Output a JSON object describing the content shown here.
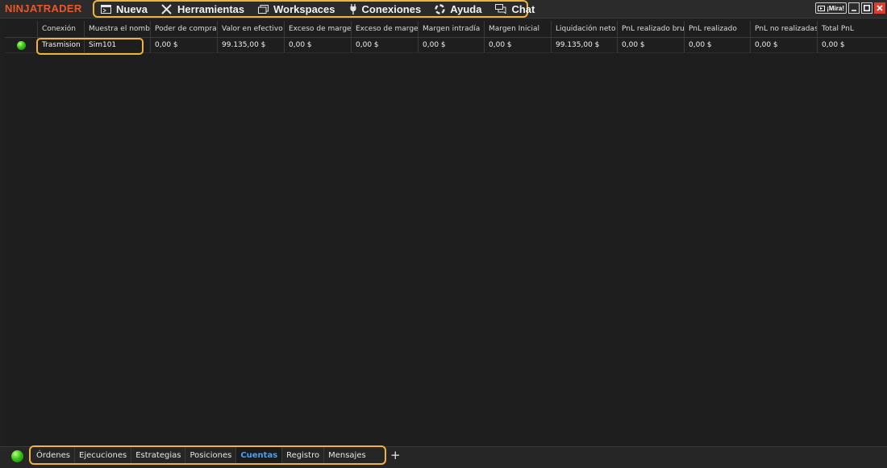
{
  "app": {
    "logo": "NINJATRADER"
  },
  "menu": [
    {
      "label": "Nueva",
      "icon": "new-window-icon"
    },
    {
      "label": "Herramientas",
      "icon": "tools-icon"
    },
    {
      "label": "Workspaces",
      "icon": "workspaces-icon"
    },
    {
      "label": "Conexiones",
      "icon": "plug-icon"
    },
    {
      "label": "Ayuda",
      "icon": "help-ring-icon"
    },
    {
      "label": "Chat",
      "icon": "chat-icon"
    }
  ],
  "window_controls": {
    "mira_label": "¡Mira!"
  },
  "accounts": {
    "columns": [
      "Conexión",
      "Muestra el nomb",
      "Poder de compra",
      "Valor en efectivo",
      "Exceso de marge",
      "Exceso de marge",
      "Margen intradía",
      "Margen Inicial",
      "Liquidación neto",
      "PnL realizado bru",
      "PnL realizado",
      "PnL no realizadas",
      "Total PnL"
    ],
    "rows": [
      [
        "Trasmision",
        "Sim101",
        "0,00 $",
        "99.135,00 $",
        "0,00 $",
        "0,00 $",
        "0,00 $",
        "0,00 $",
        "99.135,00 $",
        "0,00 $",
        "0,00 $",
        "0,00 $",
        "0,00 $"
      ]
    ],
    "status_color": "#3cc41a"
  },
  "bottom_tabs": [
    "Órdenes",
    "Ejecuciones",
    "Estrategias",
    "Posiciones",
    "Cuentas",
    "Registro",
    "Mensajes"
  ],
  "active_tab": "Cuentas",
  "add_tab_label": "+",
  "colors": {
    "accent": "#f0b33b",
    "brand": "#e8572b",
    "active_tab": "#3fa3ff",
    "background": "#1f1f1f"
  }
}
